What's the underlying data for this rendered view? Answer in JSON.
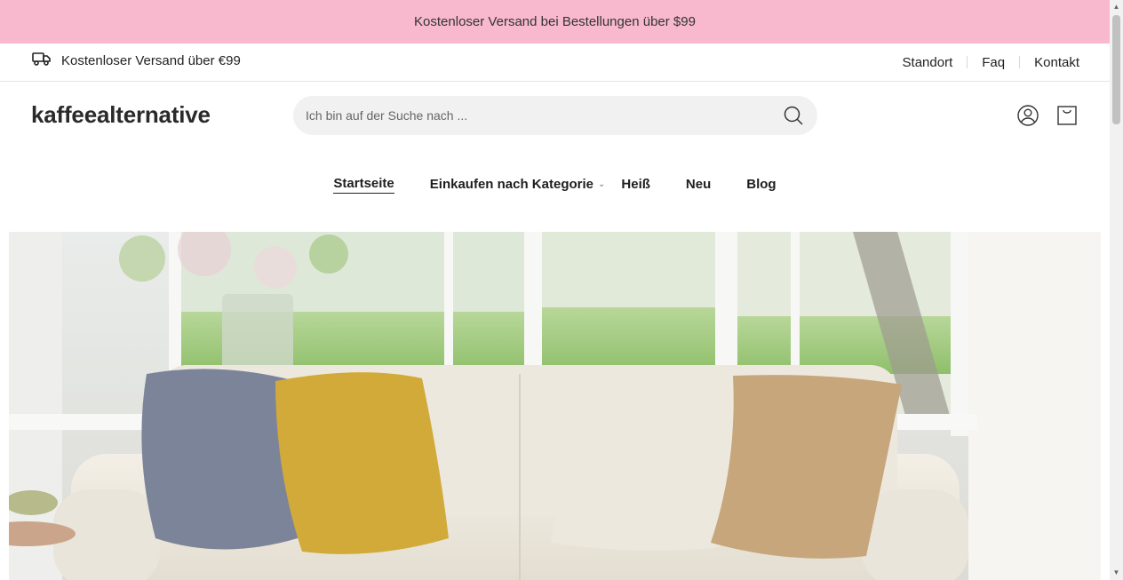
{
  "announcement": "Kostenloser Versand bei Bestellungen über $99",
  "topbar": {
    "shipping_text": "Kostenloser Versand über €99",
    "links": [
      "Standort",
      "Faq",
      "Kontakt"
    ]
  },
  "header": {
    "logo": "kaffeealternative",
    "search_placeholder": "Ich bin auf der Suche nach ..."
  },
  "nav": {
    "items": [
      {
        "label": "Startseite",
        "active": true
      },
      {
        "label": "Einkaufen nach Kategorie",
        "has_dropdown": true
      },
      {
        "label": "Heiß"
      },
      {
        "label": "Neu"
      },
      {
        "label": "Blog"
      }
    ]
  },
  "hero": {
    "description_icon": "living-room-sofa-pillows-image"
  },
  "colors": {
    "announcement_bg": "#f8b9cf",
    "search_bg": "#f1f1f1"
  }
}
